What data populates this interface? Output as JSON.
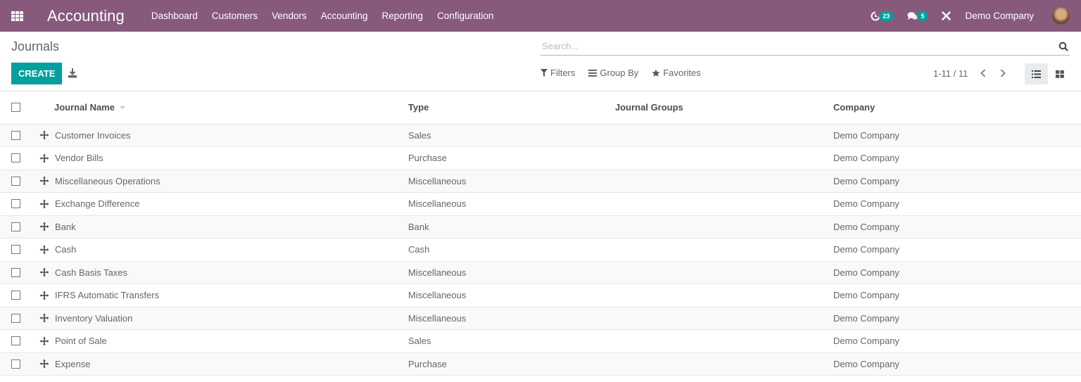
{
  "navbar": {
    "app_title": "Accounting",
    "menu": [
      "Dashboard",
      "Customers",
      "Vendors",
      "Accounting",
      "Reporting",
      "Configuration"
    ],
    "activity_count": "23",
    "messages_count": "5",
    "company": "Demo Company",
    "brand_color": "#875a7b",
    "badge_color": "#00a09d"
  },
  "control_panel": {
    "breadcrumb": "Journals",
    "create_label": "CREATE",
    "search_placeholder": "Search...",
    "search_value": "",
    "filters_label": "Filters",
    "group_by_label": "Group By",
    "favorites_label": "Favorites",
    "pager_value": "1-11 / 11",
    "active_view": "list"
  },
  "table": {
    "columns": [
      "Journal Name",
      "Type",
      "Journal Groups",
      "Company"
    ],
    "rows": [
      {
        "name": "Customer Invoices",
        "type": "Sales",
        "groups": "",
        "company": "Demo Company"
      },
      {
        "name": "Vendor Bills",
        "type": "Purchase",
        "groups": "",
        "company": "Demo Company"
      },
      {
        "name": "Miscellaneous Operations",
        "type": "Miscellaneous",
        "groups": "",
        "company": "Demo Company"
      },
      {
        "name": "Exchange Difference",
        "type": "Miscellaneous",
        "groups": "",
        "company": "Demo Company"
      },
      {
        "name": "Bank",
        "type": "Bank",
        "groups": "",
        "company": "Demo Company"
      },
      {
        "name": "Cash",
        "type": "Cash",
        "groups": "",
        "company": "Demo Company"
      },
      {
        "name": "Cash Basis Taxes",
        "type": "Miscellaneous",
        "groups": "",
        "company": "Demo Company"
      },
      {
        "name": "IFRS Automatic Transfers",
        "type": "Miscellaneous",
        "groups": "",
        "company": "Demo Company"
      },
      {
        "name": "Inventory Valuation",
        "type": "Miscellaneous",
        "groups": "",
        "company": "Demo Company"
      },
      {
        "name": "Point of Sale",
        "type": "Sales",
        "groups": "",
        "company": "Demo Company"
      },
      {
        "name": "Expense",
        "type": "Purchase",
        "groups": "",
        "company": "Demo Company"
      }
    ]
  }
}
